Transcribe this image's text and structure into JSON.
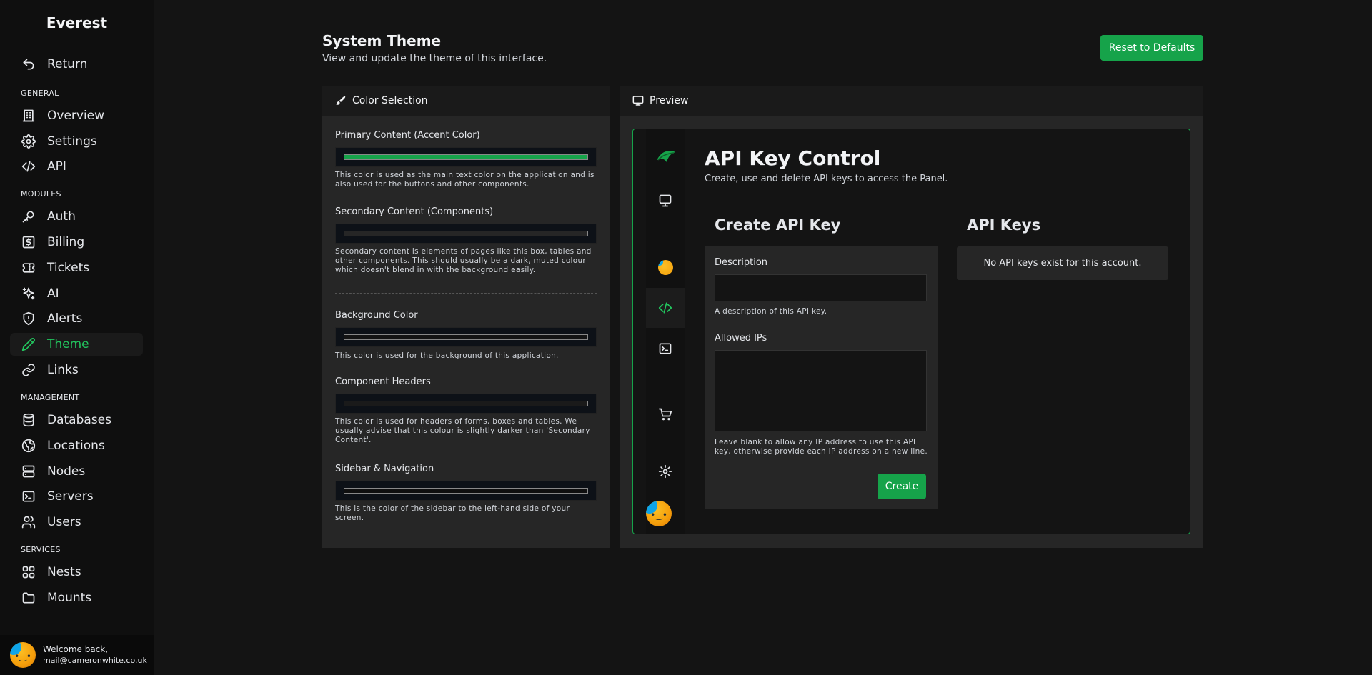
{
  "app": {
    "brand": "Everest"
  },
  "sidebar": {
    "return_label": "Return",
    "sections": {
      "general": "GENERAL",
      "modules": "MODULES",
      "management": "MANAGEMENT",
      "services": "SERVICES"
    },
    "items": {
      "overview": "Overview",
      "settings": "Settings",
      "api": "API",
      "auth": "Auth",
      "billing": "Billing",
      "tickets": "Tickets",
      "ai": "AI",
      "alerts": "Alerts",
      "theme": "Theme",
      "links": "Links",
      "databases": "Databases",
      "locations": "Locations",
      "nodes": "Nodes",
      "servers": "Servers",
      "users": "Users",
      "nests": "Nests",
      "mounts": "Mounts"
    },
    "active_item": "theme",
    "user": {
      "greeting": "Welcome back,",
      "email": "mail@cameronwhite.co.uk"
    }
  },
  "header": {
    "title": "System Theme",
    "subtitle": "View and update the theme of this interface.",
    "reset_label": "Reset to Defaults"
  },
  "color_selection": {
    "title": "Color Selection",
    "fields": {
      "primary": {
        "label": "Primary Content (Accent Color)",
        "help": "This color is used as the main text color on the application and is also used for the buttons and other components.",
        "value": "#16a34a"
      },
      "secondary": {
        "label": "Secondary Content (Components)",
        "help": "Secondary content is elements of pages like this box, tables and other components. This should usually be a dark, muted colour which doesn't blend in with the background easily.",
        "value": "#262626"
      },
      "background": {
        "label": "Background Color",
        "help": "This color is used for the background of this application.",
        "value": "#141414"
      },
      "headers": {
        "label": "Component Headers",
        "help": "This color is used for headers of forms, boxes and tables. We usually advise that this colour is slightly darker than 'Secondary Content'.",
        "value": "#1a1a1a"
      },
      "sidebar": {
        "label": "Sidebar & Navigation",
        "help": "This is the color of the sidebar to the left-hand side of your screen.",
        "value": "#0f0f0f"
      }
    }
  },
  "preview": {
    "title": "Preview",
    "page_title": "API Key Control",
    "page_subtitle": "Create, use and delete API keys to access the Panel.",
    "create_heading": "Create API Key",
    "keys_heading": "API Keys",
    "description_label": "Description",
    "description_help": "A description of this API key.",
    "ips_label": "Allowed IPs",
    "ips_help": "Leave blank to allow any IP address to use this API key, otherwise provide each IP address on a new line.",
    "create_label": "Create",
    "no_keys": "No API keys exist for this account."
  },
  "colors": {
    "accent": "#16a34a",
    "accent_text": "#22c55e"
  }
}
